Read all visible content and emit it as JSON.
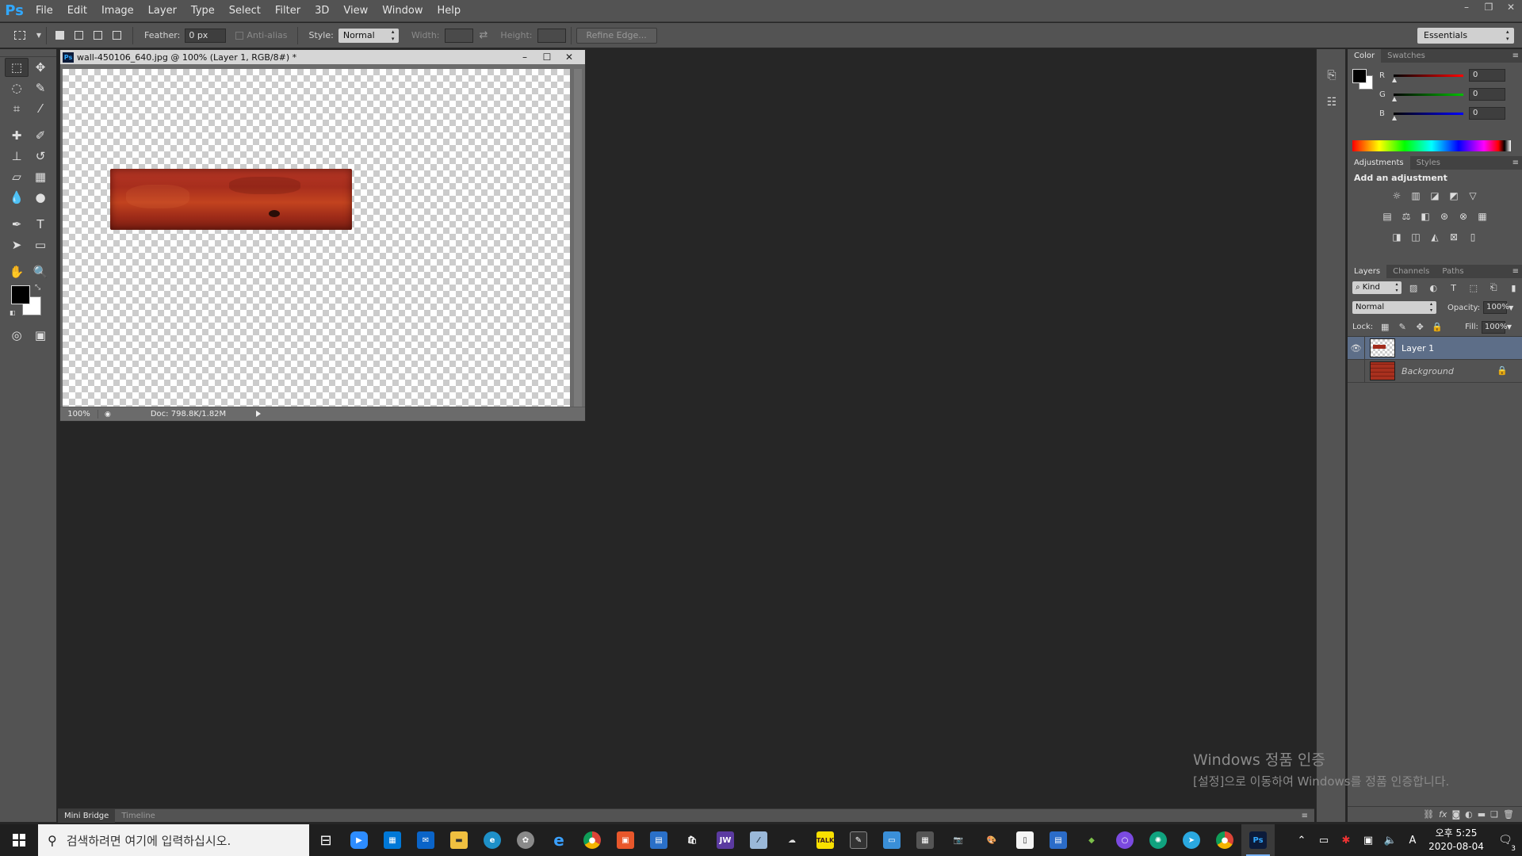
{
  "app": {
    "logo": "Ps"
  },
  "menu": [
    "File",
    "Edit",
    "Image",
    "Layer",
    "Type",
    "Select",
    "Filter",
    "3D",
    "View",
    "Window",
    "Help"
  ],
  "window_controls": {
    "minimize": "–",
    "restore": "❐",
    "close": "✕"
  },
  "options": {
    "feather_label": "Feather:",
    "feather_value": "0 px",
    "antialias_label": "Anti-alias",
    "style_label": "Style:",
    "style_value": "Normal",
    "width_label": "Width:",
    "height_label": "Height:",
    "refine_edge": "Refine Edge...",
    "workspace": "Essentials"
  },
  "document": {
    "title": "wall-450106_640.jpg @ 100% (Layer 1, RGB/8#) *",
    "zoom": "100%",
    "doc_info": "Doc: 798.8K/1.82M"
  },
  "bottom_tabs": [
    "Mini Bridge",
    "Timeline"
  ],
  "color_panel": {
    "tabs": [
      "Color",
      "Swatches"
    ],
    "channels": [
      {
        "label": "R",
        "value": "0",
        "color": "#ff0000"
      },
      {
        "label": "G",
        "value": "0",
        "color": "#00c000"
      },
      {
        "label": "B",
        "value": "0",
        "color": "#0000ff"
      }
    ]
  },
  "adjustments_panel": {
    "tabs": [
      "Adjustments",
      "Styles"
    ],
    "title": "Add an adjustment"
  },
  "layers_panel": {
    "tabs": [
      "Layers",
      "Channels",
      "Paths"
    ],
    "filter_kind": "Kind",
    "blend_mode": "Normal",
    "opacity_label": "Opacity:",
    "opacity_value": "100%",
    "lock_label": "Lock:",
    "fill_label": "Fill:",
    "fill_value": "100%",
    "layers": [
      {
        "name": "Layer 1",
        "selected": true,
        "visible": true
      },
      {
        "name": "Background",
        "selected": false,
        "visible": false,
        "locked": true
      }
    ],
    "footer_icons": [
      "link-icon",
      "fx-icon",
      "mask-icon",
      "adjustment-icon",
      "folder-icon",
      "new-layer-icon",
      "trash-icon"
    ]
  },
  "activation": {
    "line1": "Windows 정품 인증",
    "line2": "[설정]으로 이동하여 Windows를 정품 인증합니다."
  },
  "taskbar": {
    "search_placeholder": "검색하려면 여기에 입력하십시오.",
    "clock_time": "오후 5:25",
    "clock_date": "2020-08-04",
    "ime": "A",
    "notification_count": "3"
  },
  "colors": {
    "ui_bg": "#535353",
    "workspace_bg": "#262626",
    "selected_layer": "#5d6e88",
    "ps_blue": "#31a8ff"
  }
}
